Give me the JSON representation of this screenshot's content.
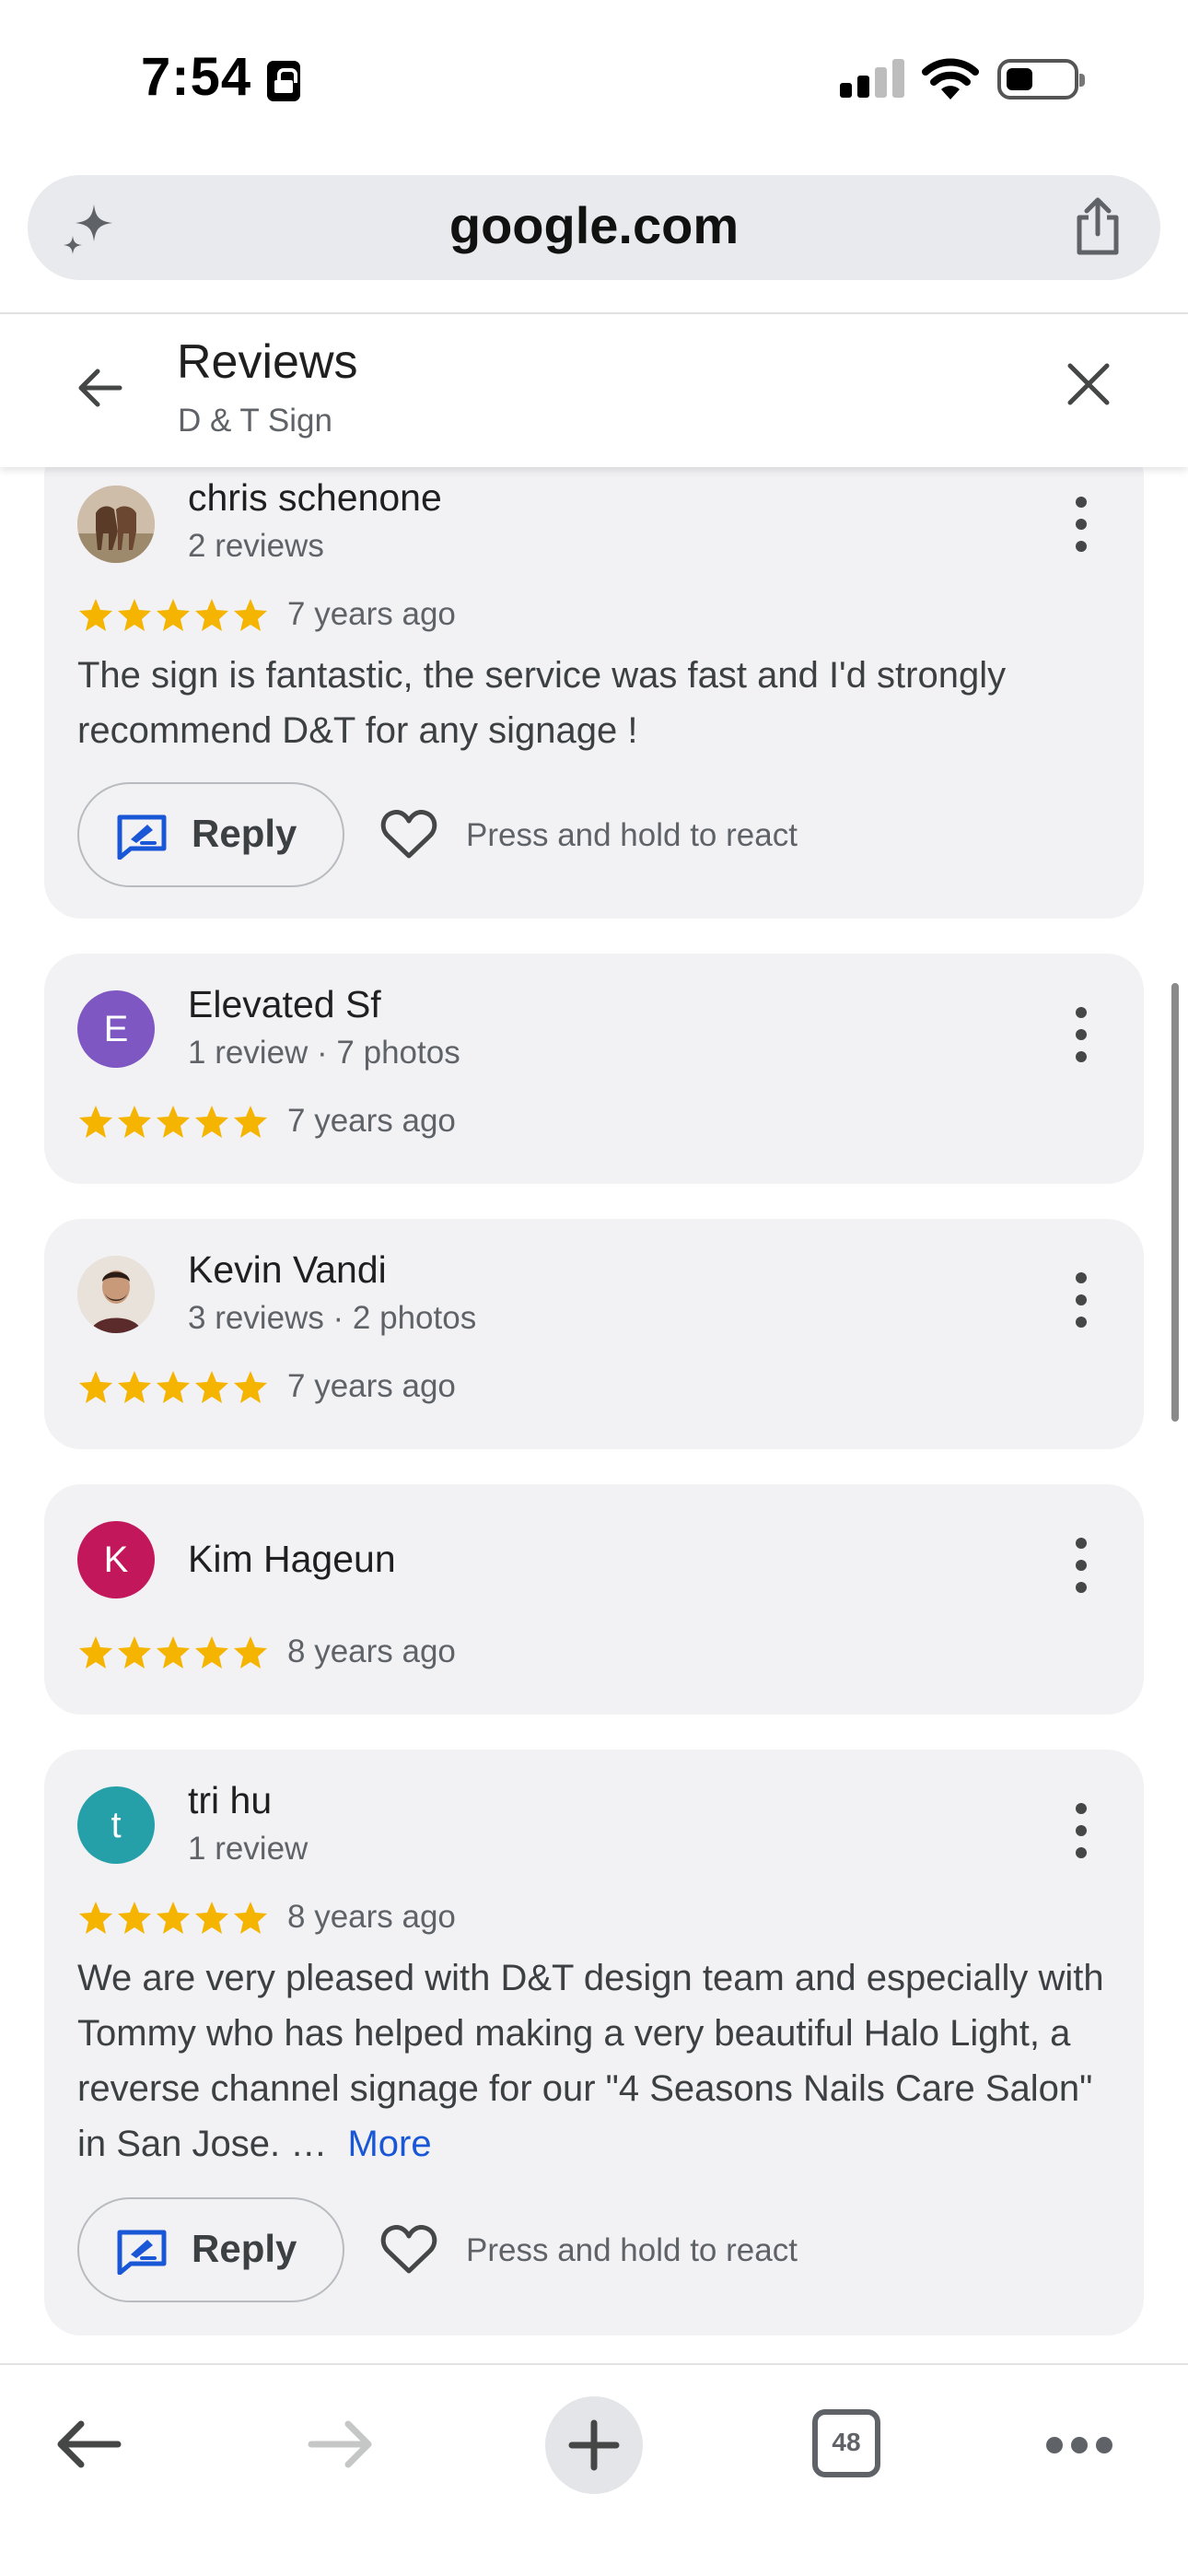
{
  "status_bar": {
    "time": "7:54"
  },
  "browser": {
    "url": "google.com",
    "tab_count": "48"
  },
  "panel": {
    "title": "Reviews",
    "subtitle": "D & T Sign"
  },
  "colors": {
    "star": "#f4b400",
    "link": "#1a57d6",
    "card_bg": "#f2f2f5"
  },
  "reviews": [
    {
      "name": "chris schenone",
      "meta": "2 reviews",
      "rating": 5,
      "date": "7 years ago",
      "text": "The sign is fantastic, the service was fast and I'd strongly recommend D&T for any signage !",
      "avatar": "photo-horses",
      "reply_label": "Reply",
      "react_hint": "Press and hold to react"
    },
    {
      "name": "Elevated Sf",
      "meta": "1 review · 7 photos",
      "rating": 5,
      "date": "7 years ago",
      "avatar_letter": "E",
      "avatar_color": "#7e57c2"
    },
    {
      "name": "Kevin Vandi",
      "meta": "3 reviews · 2 photos",
      "rating": 5,
      "date": "7 years ago",
      "avatar": "photo-person"
    },
    {
      "name": "Kim Hageun",
      "rating": 5,
      "date": "8 years ago",
      "avatar_letter": "K",
      "avatar_color": "#c2185b"
    },
    {
      "name": "tri hu",
      "meta": "1 review",
      "rating": 5,
      "date": "8 years ago",
      "text": "We are very pleased with D&T design team and especially with Tommy who has helped making a very beautiful Halo Light, a reverse channel signage for our \"4 Seasons Nails Care Salon\" in San Jose. …",
      "more_label": "More",
      "avatar_letter": "t",
      "avatar_color": "#26a0a8",
      "reply_label": "Reply",
      "react_hint": "Press and hold to react"
    }
  ]
}
